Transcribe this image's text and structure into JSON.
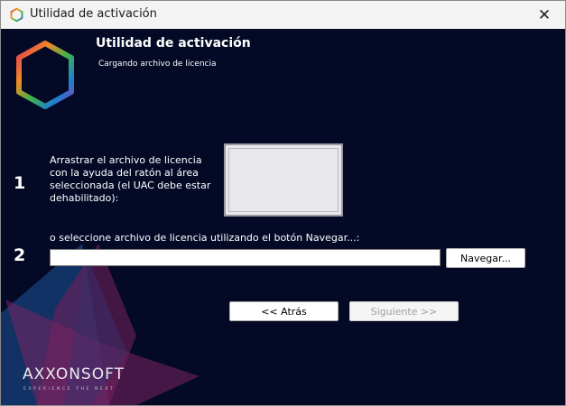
{
  "window": {
    "title": "Utilidad de activación",
    "close_glyph": "✕"
  },
  "header": {
    "title": "Utilidad de activación",
    "subtitle": "Cargando archivo de licencia"
  },
  "step1": {
    "number": "1",
    "text": "Arrastrar el archivo de licencia con la ayuda del ratón al área seleccionada (el UAC debe estar dehabilitado):"
  },
  "step2": {
    "number": "2",
    "text": "o seleccione archivo de licencia utilizando el botón Navegar...:",
    "file_value": ""
  },
  "buttons": {
    "browse": "Navegar...",
    "back": "<< Atrás",
    "next": "Siguiente >>"
  },
  "brand": {
    "name": "AXXONSOFT",
    "tagline": "EXPERIENCE THE NEXT"
  },
  "colors": {
    "background": "#040a26",
    "accent_magenta": "#8c2a6e",
    "accent_blue": "#1c4f8f"
  },
  "icons": {
    "app": "hexagon-logo-icon",
    "close": "close-icon"
  }
}
